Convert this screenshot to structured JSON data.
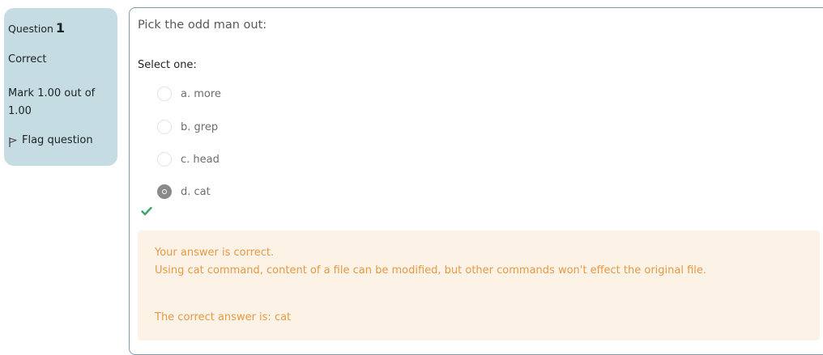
{
  "info": {
    "question_label": "Question",
    "question_number": "1",
    "state": "Correct",
    "grade": "Mark 1.00 out of 1.00",
    "flag_label": "Flag question",
    "flag_icon": "flag-outline-icon"
  },
  "question": {
    "text": "Pick the odd man out:",
    "prompt": "Select one:",
    "answers": [
      {
        "label": "a. more",
        "checked": false
      },
      {
        "label": "b. grep",
        "checked": false
      },
      {
        "label": "c. head",
        "checked": false
      },
      {
        "label": "d. cat",
        "checked": true
      }
    ],
    "correct_icon": "checkmark-icon",
    "correct_icon_color": "#3aa66b"
  },
  "feedback": {
    "specific": "Your answer is correct.",
    "general": "Using cat command, content of a file can be modified, but other commands won't effect the original file.",
    "right_answer": "The correct answer is: cat",
    "background_color": "#fdf2e6",
    "text_color": "#e59a45"
  },
  "colors": {
    "info_background": "#c5dde2",
    "content_border": "#7f9ba6"
  }
}
